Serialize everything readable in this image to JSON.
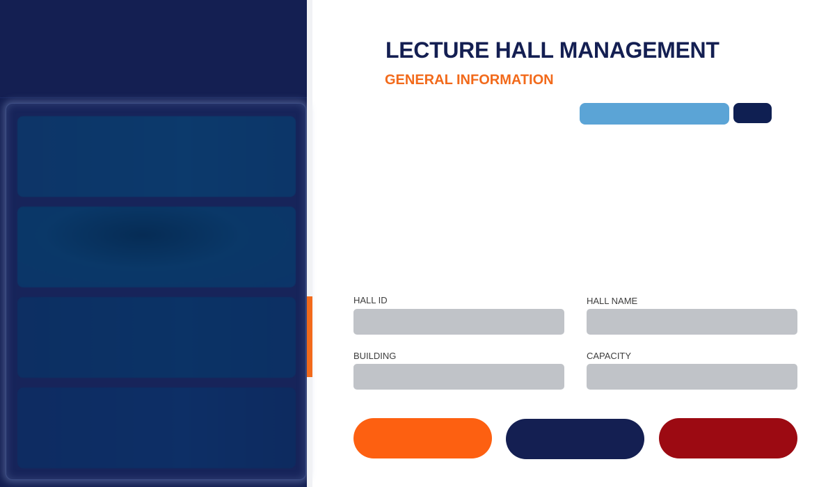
{
  "header": {
    "title": "LECTURE HALL MANAGEMENT",
    "subtitle": "GENERAL INFORMATION"
  },
  "search": {
    "value": "",
    "placeholder": "",
    "button_label": ""
  },
  "form": {
    "fields": [
      {
        "key": "hall_id",
        "label": "HALL ID",
        "value": ""
      },
      {
        "key": "hall_name",
        "label": "HALL NAME",
        "value": ""
      },
      {
        "key": "building",
        "label": "BUILDING",
        "value": ""
      },
      {
        "key": "capacity",
        "label": "CAPACITY",
        "value": ""
      }
    ]
  },
  "actions": {
    "buttons": [
      {
        "label": "",
        "color": "#fd6011"
      },
      {
        "label": "",
        "color": "#141f52"
      },
      {
        "label": "",
        "color": "#9c0a12"
      }
    ]
  },
  "theme": {
    "primary": "#141f52",
    "accent": "#f26a1b",
    "search_bg": "#5ba4d6",
    "input_bg": "#c0c3c8",
    "danger": "#9c0a12"
  }
}
